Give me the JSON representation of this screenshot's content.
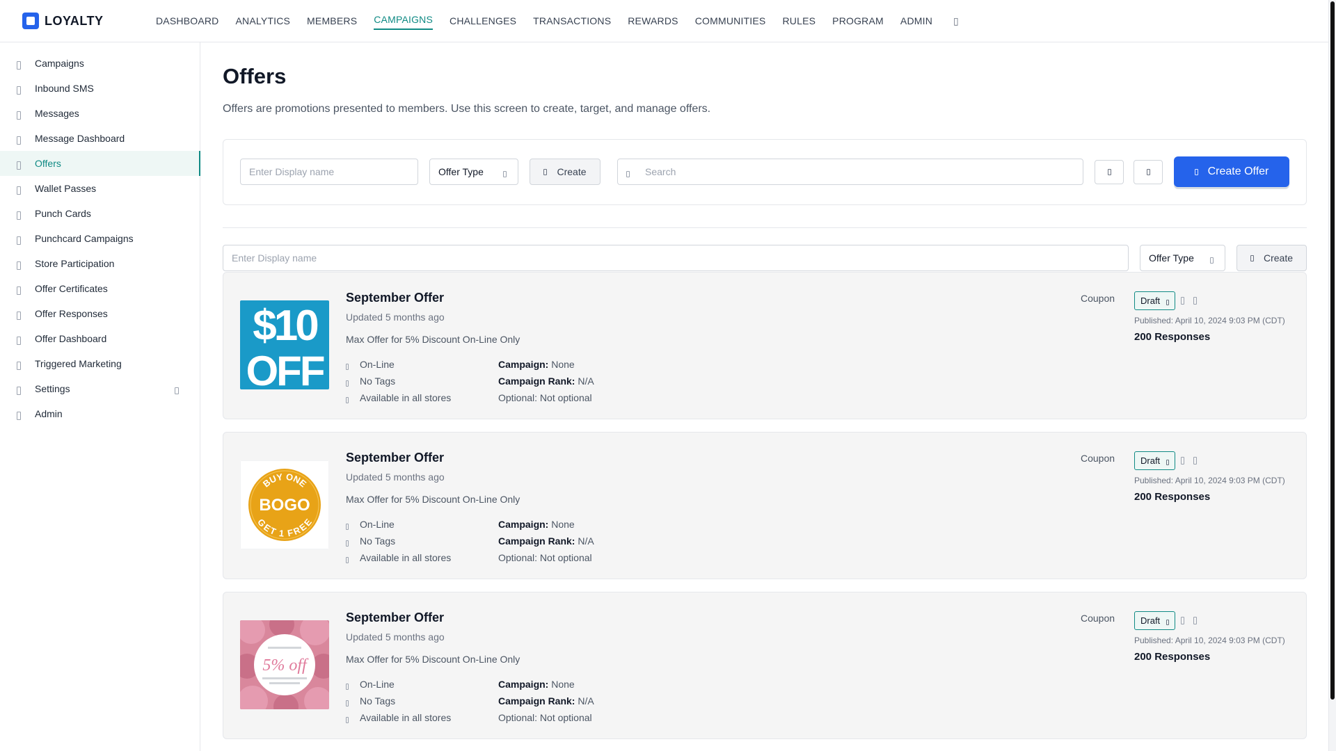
{
  "app": {
    "brand": "LOYALTY"
  },
  "topnav": [
    {
      "label": "DASHBOARD"
    },
    {
      "label": "ANALYTICS"
    },
    {
      "label": "MEMBERS"
    },
    {
      "label": "CAMPAIGNS",
      "active": true
    },
    {
      "label": "CHALLENGES"
    },
    {
      "label": "TRANSACTIONS"
    },
    {
      "label": "REWARDS"
    },
    {
      "label": "COMMUNITIES"
    },
    {
      "label": "RULES"
    },
    {
      "label": "PROGRAM"
    },
    {
      "label": "ADMIN"
    }
  ],
  "sidebar": [
    {
      "label": "Campaigns"
    },
    {
      "label": "Inbound SMS"
    },
    {
      "label": "Messages"
    },
    {
      "label": "Message Dashboard"
    },
    {
      "label": "Offers",
      "active": true
    },
    {
      "label": "Wallet Passes"
    },
    {
      "label": "Punch Cards"
    },
    {
      "label": "Punchcard Campaigns"
    },
    {
      "label": "Store Participation"
    },
    {
      "label": "Offer Certificates"
    },
    {
      "label": "Offer Responses"
    },
    {
      "label": "Offer Dashboard"
    },
    {
      "label": "Triggered Marketing"
    },
    {
      "label": "Settings",
      "expandable": true
    },
    {
      "label": "Admin"
    }
  ],
  "page": {
    "title": "Offers",
    "description": "Offers are promotions presented to members. Use this screen to create, target, and manage offers."
  },
  "toolbar": {
    "display_name_placeholder": "Enter Display name",
    "offer_type_label": "Offer Type",
    "create_label": "Create",
    "search_placeholder": "Search",
    "create_offer_label": "Create Offer"
  },
  "filter": {
    "display_name_placeholder": "Enter Display name",
    "offer_type_label": "Offer Type",
    "create_label": "Create"
  },
  "colors": {
    "accent": "#0f8a84",
    "primary": "#2563eb"
  },
  "offers": [
    {
      "title": "September Offer",
      "updated": "Updated 5 months ago",
      "description": "Max Offer for 5% Discount On-Line Only",
      "channel": "On-Line",
      "tags": "No Tags",
      "stores": "Available in all stores",
      "campaign_label": "Campaign:",
      "campaign_value": " None",
      "rank_label": "Campaign Rank:",
      "rank_value": " N/A",
      "optional": "Optional: Not optional",
      "type": "Coupon",
      "status": "Draft",
      "published": "Published: April 10, 2024 9:03 PM (CDT)",
      "responses": "200 Responses",
      "image": {
        "kind": "ten-off",
        "line1": "$10",
        "line2": "OFF"
      }
    },
    {
      "title": "September Offer",
      "updated": "Updated 5 months ago",
      "description": "Max Offer for 5% Discount On-Line Only",
      "channel": "On-Line",
      "tags": "No Tags",
      "stores": "Available in all stores",
      "campaign_label": "Campaign:",
      "campaign_value": " None",
      "rank_label": "Campaign Rank:",
      "rank_value": " N/A",
      "optional": "Optional: Not optional",
      "type": "Coupon",
      "status": "Draft",
      "published": "Published: April 10, 2024 9:03 PM (CDT)",
      "responses": "200 Responses",
      "image": {
        "kind": "bogo",
        "top": "BUY ONE",
        "middle": "BOGO",
        "bottom": "GET 1 FREE"
      }
    },
    {
      "title": "September Offer",
      "updated": "Updated 5 months ago",
      "description": "Max Offer for 5% Discount On-Line Only",
      "channel": "On-Line",
      "tags": "No Tags",
      "stores": "Available in all stores",
      "campaign_label": "Campaign:",
      "campaign_value": " None",
      "rank_label": "Campaign Rank:",
      "rank_value": " N/A",
      "optional": "Optional: Not optional",
      "type": "Coupon",
      "status": "Draft",
      "published": "Published: April 10, 2024 9:03 PM (CDT)",
      "responses": "200 Responses",
      "image": {
        "kind": "five-off",
        "text": "5% off"
      }
    }
  ]
}
